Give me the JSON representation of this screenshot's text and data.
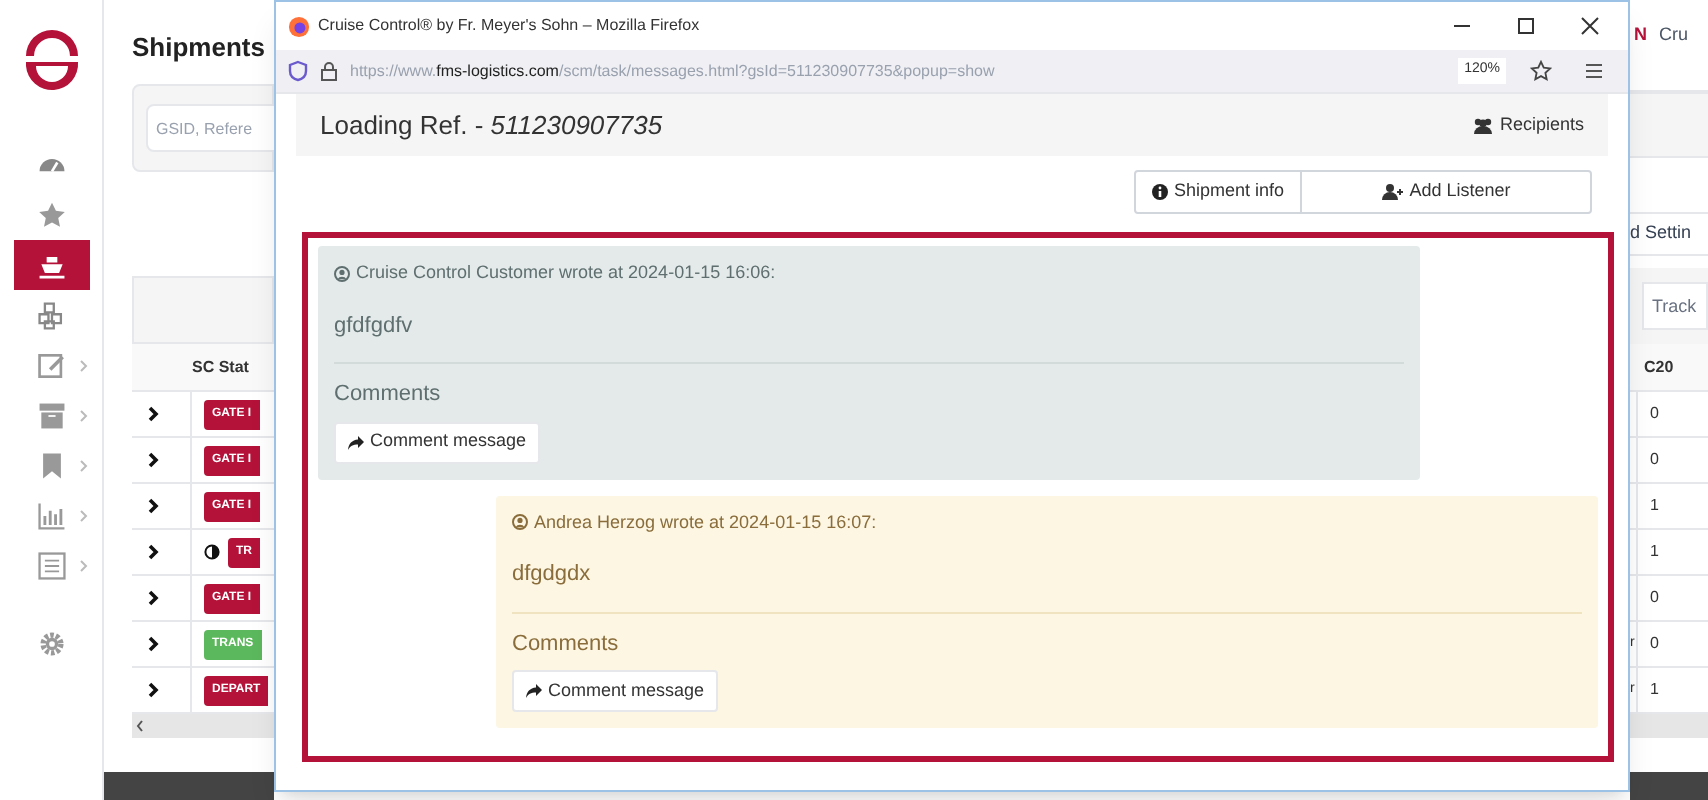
{
  "app": {
    "title": "Shipments",
    "user_badge": "N",
    "user_name": "Cru",
    "search": {
      "placeholder": "GSID, Refere"
    },
    "settings_link": "d Settin",
    "track_field": {
      "placeholder": "Track"
    }
  },
  "sidebar": {
    "items": [
      {
        "kind": "dashboard",
        "selected": false,
        "submenu": false
      },
      {
        "kind": "star",
        "selected": false,
        "submenu": false
      },
      {
        "kind": "ship",
        "selected": true,
        "submenu": false
      },
      {
        "kind": "cubes",
        "selected": false,
        "submenu": false
      },
      {
        "kind": "edit",
        "selected": false,
        "submenu": true
      },
      {
        "kind": "archive",
        "selected": false,
        "submenu": true
      },
      {
        "kind": "bookmark",
        "selected": false,
        "submenu": true
      },
      {
        "kind": "chart",
        "selected": false,
        "submenu": true
      },
      {
        "kind": "list",
        "selected": false,
        "submenu": true
      },
      {
        "kind": "gear",
        "selected": false,
        "submenu": false
      }
    ]
  },
  "table": {
    "columns": [
      "SC Stat",
      "C20"
    ],
    "rows": [
      {
        "status": "GATE I",
        "color": "#b5123a",
        "halfmoon": false,
        "column_2": "",
        "column_3": "0"
      },
      {
        "status": "GATE I",
        "color": "#b5123a",
        "halfmoon": false,
        "column_2": "",
        "column_3": "0"
      },
      {
        "status": "GATE I",
        "color": "#b5123a",
        "halfmoon": false,
        "column_2": "",
        "column_3": "1"
      },
      {
        "status": "TR",
        "color": "#b5123a",
        "halfmoon": true,
        "column_2": "",
        "column_3": "1"
      },
      {
        "status": "GATE I",
        "color": "#b5123a",
        "halfmoon": false,
        "column_2": "",
        "column_3": "0"
      },
      {
        "status": "TRANS",
        "color": "#5cb85c",
        "halfmoon": false,
        "column_2": "r",
        "column_3": "0"
      },
      {
        "status": "DEPART",
        "color": "#b5123a",
        "halfmoon": false,
        "column_2": "r",
        "column_3": "1"
      }
    ]
  },
  "popup": {
    "title": "Cruise Control® by Fr. Meyer's Sohn – Mozilla Firefox",
    "url": {
      "prefix": "https://www.",
      "domain": "fms-logistics.com",
      "path": "/scm/task/messages.html?gsId=511230907735&popup=show"
    },
    "zoom": "120%",
    "header": {
      "label": "Loading Ref. - ",
      "reference": "511230907735",
      "recipients": "Recipients"
    },
    "buttons": [
      {
        "kind": "info",
        "label": "Shipment info"
      },
      {
        "kind": "add-user",
        "label": "Add Listener"
      }
    ],
    "messages": [
      {
        "kind": "incoming",
        "author_line": "Cruise Control Customer wrote at 2024-01-15 16:06:",
        "body": "gfdfgdfv",
        "comments_label": "Comments",
        "button": "Comment message"
      },
      {
        "kind": "outgoing",
        "author_line": "Andrea Herzog wrote at 2024-01-15 16:07:",
        "body": "dfgdgdx",
        "comments_label": "Comments",
        "button": "Comment message"
      }
    ]
  }
}
